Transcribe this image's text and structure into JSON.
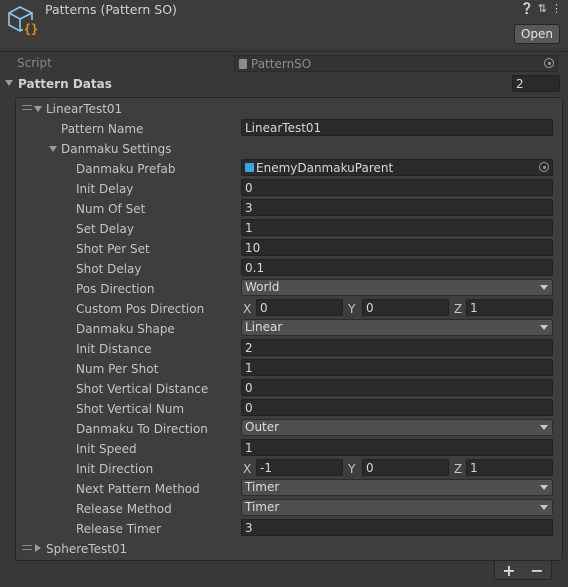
{
  "header": {
    "title": "Patterns (Pattern SO)",
    "open_label": "Open",
    "icons": [
      "help-icon",
      "settings-sliders-icon",
      "more-vert-icon"
    ]
  },
  "script": {
    "label": "Script",
    "value": "PatternSO"
  },
  "pattern_datas": {
    "label": "Pattern Datas",
    "count": "2"
  },
  "elements": [
    {
      "label": "LinearTest01",
      "expanded": true
    },
    {
      "label": "SphereTest01",
      "expanded": false
    }
  ],
  "fields": {
    "pattern_name": {
      "label": "Pattern Name",
      "value": "LinearTest01"
    },
    "danmaku_settings": {
      "label": "Danmaku Settings"
    },
    "danmaku_prefab": {
      "label": "Danmaku Prefab",
      "value": "EnemyDanmakuParent"
    },
    "init_delay": {
      "label": "Init Delay",
      "value": "0"
    },
    "num_of_set": {
      "label": "Num Of Set",
      "value": "3"
    },
    "set_delay": {
      "label": "Set Delay",
      "value": "1"
    },
    "shot_per_set": {
      "label": "Shot Per Set",
      "value": "10"
    },
    "shot_delay": {
      "label": "Shot Delay",
      "value": "0.1"
    },
    "pos_direction": {
      "label": "Pos Direction",
      "value": "World"
    },
    "custom_pos_direction": {
      "label": "Custom Pos Direction",
      "x": "0",
      "y": "0",
      "z": "1"
    },
    "danmaku_shape": {
      "label": "Danmaku Shape",
      "value": "Linear"
    },
    "init_distance": {
      "label": "Init Distance",
      "value": "2"
    },
    "num_per_shot": {
      "label": "Num Per Shot",
      "value": "1"
    },
    "shot_vertical_distance": {
      "label": "Shot Vertical Distance",
      "value": "0"
    },
    "shot_vertical_num": {
      "label": "Shot Vertical Num",
      "value": "0"
    },
    "danmaku_to_direction": {
      "label": "Danmaku To Direction",
      "value": "Outer"
    },
    "init_speed": {
      "label": "Init Speed",
      "value": "1"
    },
    "init_direction": {
      "label": "Init Direction",
      "x": "-1",
      "y": "0",
      "z": "1"
    },
    "next_pattern_method": {
      "label": "Next Pattern Method",
      "value": "Timer"
    },
    "release_method": {
      "label": "Release Method",
      "value": "Timer"
    },
    "release_timer": {
      "label": "Release Timer",
      "value": "3"
    }
  },
  "axis_labels": {
    "x": "X",
    "y": "Y",
    "z": "Z"
  },
  "footer": {
    "add": "+",
    "remove": "−"
  },
  "colors": {
    "background": "#383838",
    "field": "#2a2a2a",
    "accent_icon": "#38a7e0",
    "script_icon": "#f08a24"
  }
}
